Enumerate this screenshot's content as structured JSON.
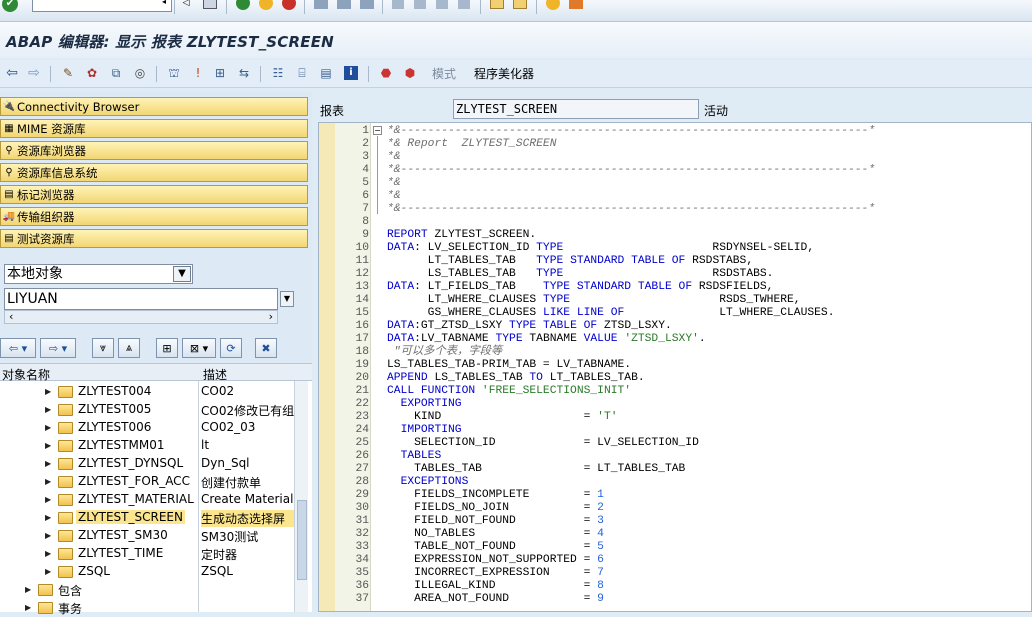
{
  "window": {
    "title": "ABAP 编辑器: 显示 报表 ZLYTEST_SCREEN"
  },
  "toolbar2": {
    "mode_label": "模式",
    "pretty_printer_label": "程序美化器"
  },
  "nav_buttons": [
    {
      "label": "Connectivity Browser",
      "icon": "connectivity-icon"
    },
    {
      "label": "MIME 资源库",
      "icon": "mime-icon"
    },
    {
      "label": "资源库浏览器",
      "icon": "repository-browser-icon"
    },
    {
      "label": "资源库信息系统",
      "icon": "repository-info-icon"
    },
    {
      "label": "标记浏览器",
      "icon": "tag-browser-icon"
    },
    {
      "label": "传输组织器",
      "icon": "transport-organizer-icon"
    },
    {
      "label": "测试资源库",
      "icon": "test-repository-icon"
    }
  ],
  "object_selector": {
    "value": "本地对象"
  },
  "user_field": {
    "value": "LIYUAN"
  },
  "tree": {
    "col_name": "对象名称",
    "col_desc": "描述",
    "rows": [
      {
        "name": "ZLYTEST004",
        "desc": "CO02"
      },
      {
        "name": "ZLYTEST005",
        "desc": "CO02修改已有组"
      },
      {
        "name": "ZLYTEST006",
        "desc": "CO02_03"
      },
      {
        "name": "ZLYTESTMM01",
        "desc": "lt"
      },
      {
        "name": "ZLYTEST_DYNSQL",
        "desc": "Dyn_Sql"
      },
      {
        "name": "ZLYTEST_FOR_ACC",
        "desc": "创建付款单"
      },
      {
        "name": "ZLYTEST_MATERIAL",
        "desc": "Create Material r"
      },
      {
        "name": "ZLYTEST_SCREEN",
        "desc": "生成动态选择屏"
      },
      {
        "name": "ZLYTEST_SM30",
        "desc": "SM30测试"
      },
      {
        "name": "ZLYTEST_TIME",
        "desc": "定时器"
      },
      {
        "name": "ZSQL",
        "desc": "ZSQL"
      }
    ],
    "packages": [
      {
        "name": "包含"
      },
      {
        "name": "事务"
      }
    ]
  },
  "report": {
    "label": "报表",
    "name": "ZLYTEST_SCREEN",
    "status": "活动"
  },
  "code": {
    "line_numbers": [
      "1",
      "2",
      "3",
      "4",
      "5",
      "6",
      "7",
      "8",
      "9",
      "10",
      "11",
      "12",
      "13",
      "14",
      "15",
      "16",
      "17",
      "18",
      "19",
      "20",
      "21",
      "22",
      "23",
      "24",
      "25",
      "26",
      "27",
      "28",
      "29",
      "30",
      "31",
      "32",
      "33",
      "34",
      "35",
      "36",
      "37"
    ],
    "lines": [
      "*&---------------------------------------------------------------------*",
      "*& Report  ZLYTEST_SCREEN",
      "*&",
      "*&---------------------------------------------------------------------*",
      "*&",
      "*&",
      "*&---------------------------------------------------------------------*",
      "",
      "REPORT ZLYTEST_SCREEN.",
      "DATA: LV_SELECTION_ID TYPE                      RSDYNSEL-SELID,",
      "      LT_TABLES_TAB   TYPE STANDARD TABLE OF RSDSTABS,",
      "      LS_TABLES_TAB   TYPE                      RSDSTABS.",
      "DATA: LT_FIELDS_TAB    TYPE STANDARD TABLE OF RSDSFIELDS,",
      "      LT_WHERE_CLAUSES TYPE                      RSDS_TWHERE,",
      "      GS_WHERE_CLAUSES LIKE LINE OF              LT_WHERE_CLAUSES.",
      "DATA:GT_ZTSD_LSXY TYPE TABLE OF ZTSD_LSXY.",
      "DATA:LV_TABNAME TYPE TABNAME VALUE 'ZTSD_LSXY'.",
      " \"可以多个表，字段等",
      "LS_TABLES_TAB-PRIM_TAB = LV_TABNAME.",
      "APPEND LS_TABLES_TAB TO LT_TABLES_TAB.",
      "CALL FUNCTION 'FREE_SELECTIONS_INIT'",
      "  EXPORTING",
      "    KIND                     = 'T'",
      "  IMPORTING",
      "    SELECTION_ID             = LV_SELECTION_ID",
      "  TABLES",
      "    TABLES_TAB               = LT_TABLES_TAB",
      "  EXCEPTIONS",
      "    FIELDS_INCOMPLETE        = 1",
      "    FIELDS_NO_JOIN           = 2",
      "    FIELD_NOT_FOUND          = 3",
      "    NO_TABLES                = 4",
      "    TABLE_NOT_FOUND          = 5",
      "    EXPRESSION_NOT_SUPPORTED = 6",
      "    INCORRECT_EXPRESSION     = 7",
      "    ILLEGAL_KIND             = 8",
      "    AREA_NOT_FOUND           = 9"
    ]
  }
}
